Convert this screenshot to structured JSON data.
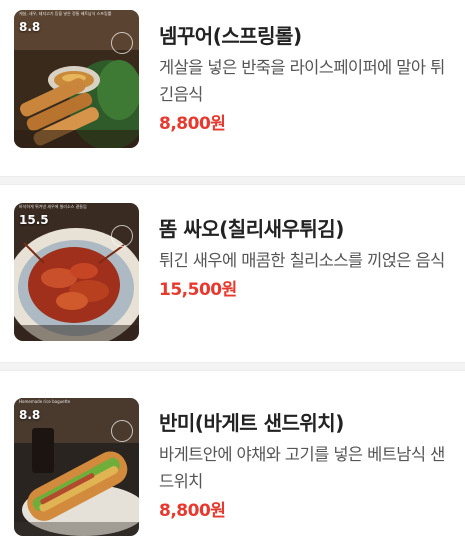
{
  "menu": {
    "items": [
      {
        "name": "넴꾸어(스프링롤)",
        "description": "게살을 넣은 반죽을 라이스페이퍼에 말아 튀긴음식",
        "price": "8,800원",
        "thumb_badge": "8.8",
        "thumb_icon": "spring-roll-photo"
      },
      {
        "name": "똠 싸오(칠리새우튀김)",
        "description": "튀긴 새우에 매콤한 칠리소스를 끼얹은 음식",
        "price": "15,500원",
        "thumb_badge": "15.5",
        "thumb_icon": "chili-shrimp-photo"
      },
      {
        "name": "반미(바게트 샌드위치)",
        "description": "바게트안에 야채와 고기를 넣은 베트남식 샌드위치",
        "price": "8,800원",
        "thumb_badge": "8.8",
        "thumb_caption": "Homemade rice baguette",
        "thumb_icon": "banh-mi-photo"
      }
    ]
  },
  "colors": {
    "price": "#e8392f",
    "name": "#222222",
    "description": "#555555",
    "divider": "#f3f3f3"
  }
}
